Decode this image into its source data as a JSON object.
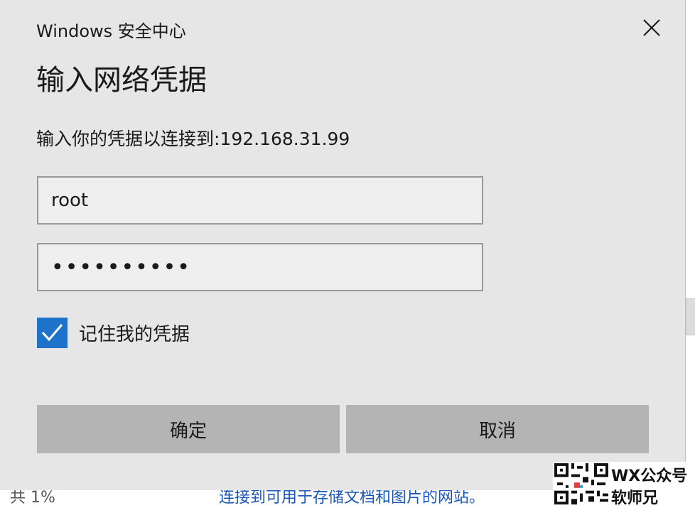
{
  "dialog": {
    "app_title": "Windows 安全中心",
    "heading": "输入网络凭据",
    "prompt": "输入你的凭据以连接到:192.168.31.99",
    "username_value": "root",
    "password_value": "••••••••••",
    "remember_label": "记住我的凭据",
    "remember_checked": true,
    "ok_label": "确定",
    "cancel_label": "取消"
  },
  "background": {
    "left_text": "共 1%",
    "link_text": "连接到可用于存储文档和图片的网站。"
  },
  "watermark": {
    "line1": "WX公众号",
    "line2": "软师兄"
  },
  "colors": {
    "dialog_bg": "#e6e6e6",
    "accent": "#1c73c9",
    "button_bg": "#b4b4b4",
    "field_bg": "#efefef"
  },
  "icons": {
    "close": "close-icon",
    "check": "checkmark-icon",
    "qr": "qr-code-icon"
  }
}
